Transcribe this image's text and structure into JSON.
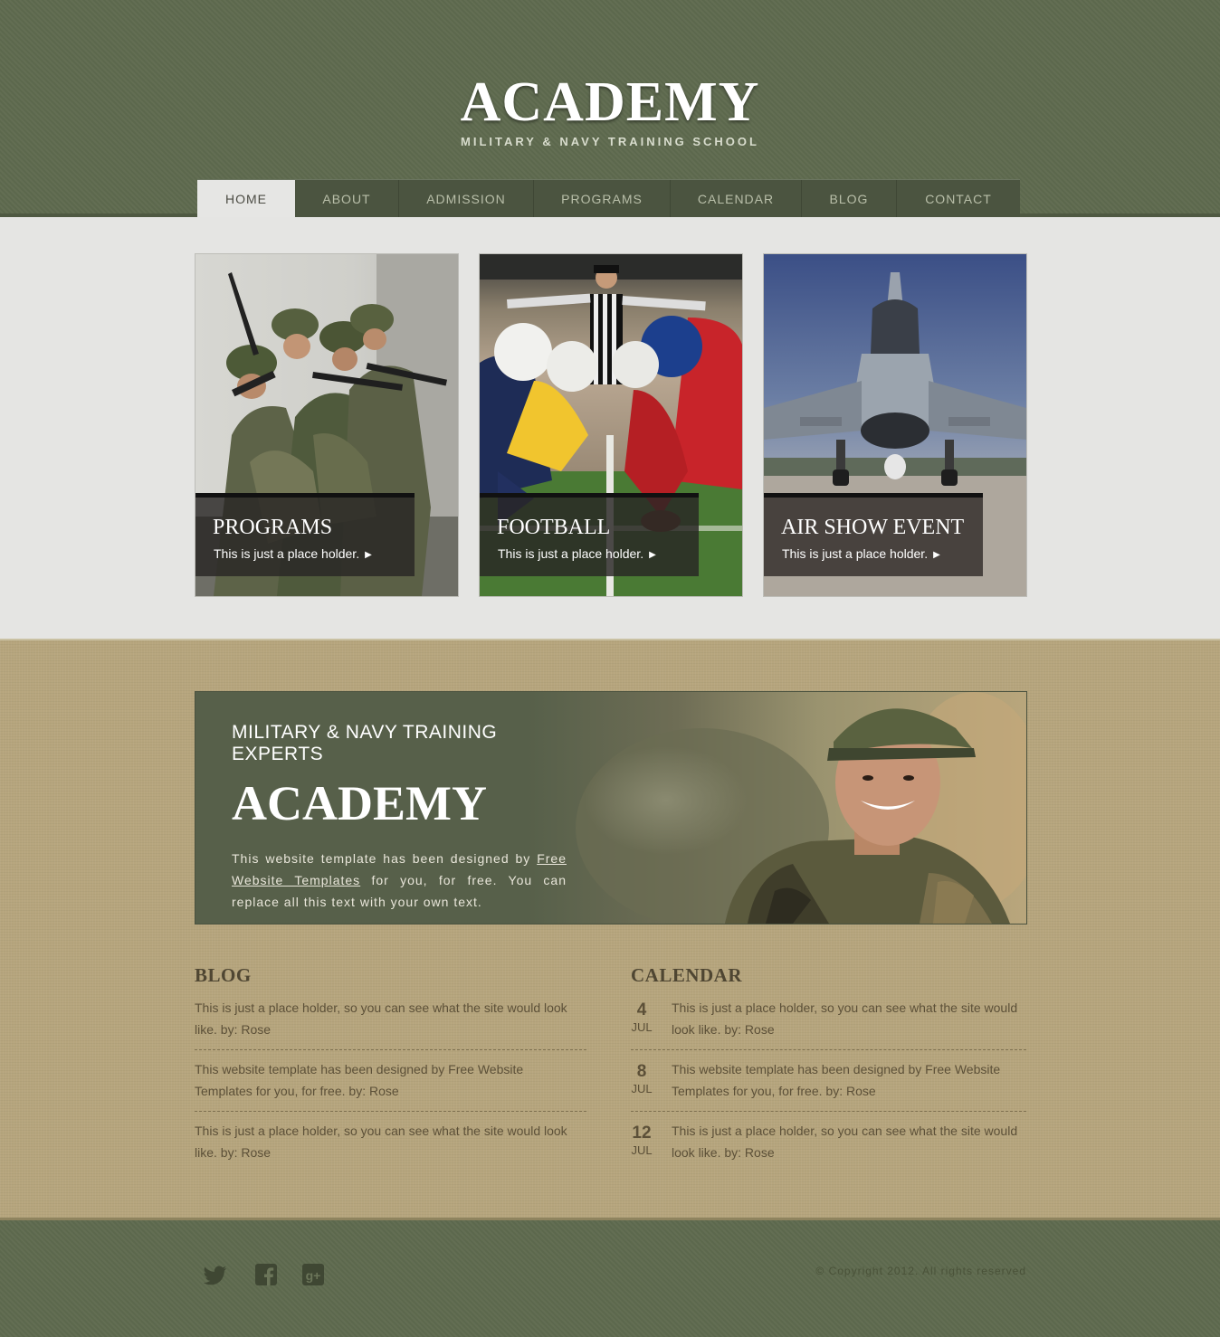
{
  "header": {
    "title": "ACADEMY",
    "subtitle": "MILITARY & NAVY TRAINING  SCHOOL"
  },
  "nav": {
    "items": [
      "HOME",
      "ABOUT",
      "ADMISSION",
      "PROGRAMS",
      "CALENDAR",
      "BLOG",
      "CONTACT"
    ],
    "active": "HOME"
  },
  "features": [
    {
      "title": "PROGRAMS",
      "desc": "This is just a place holder."
    },
    {
      "title": "FOOTBALL",
      "desc": "This is just a place holder."
    },
    {
      "title": "AIR SHOW EVENT",
      "desc": "This is just a place holder."
    }
  ],
  "banner": {
    "kicker": "MILITARY & NAVY TRAINING EXPERTS",
    "title": "ACADEMY",
    "text_before": "This website template has been designed by ",
    "link": "Free Website Templates",
    "text_after": " for you, for free. You can replace all this text with your own text."
  },
  "blog": {
    "title": "BLOG",
    "entries": [
      "This is just a place holder, so you can see what the site would look like. by: Rose",
      "This website template has been designed by Free Website Templates for you, for free. by: Rose",
      "This is just a place holder, so you can see what the site would look like. by: Rose"
    ]
  },
  "calendar": {
    "title": "CALENDAR",
    "entries": [
      {
        "day": "4",
        "month": "JUL",
        "text": "This is just a place holder, so you can see what the site would look like. by: Rose"
      },
      {
        "day": "8",
        "month": "JUL",
        "text": "This website template has been designed by Free Website Templates for you, for free. by: Rose"
      },
      {
        "day": "12",
        "month": "JUL",
        "text": "This is just a place holder, so you can see what the site would look like. by: Rose"
      }
    ]
  },
  "footer": {
    "social": [
      "twitter-icon",
      "facebook-icon",
      "google-plus-icon"
    ],
    "copyright": "© Copyright 2012. All rights reserved"
  },
  "colors": {
    "header_bg": "#5f6b4f",
    "features_bg": "#e5e5e3",
    "main_bg": "#b6a57d",
    "banner_bg": "#57604a",
    "text_brown": "#5c5038"
  }
}
